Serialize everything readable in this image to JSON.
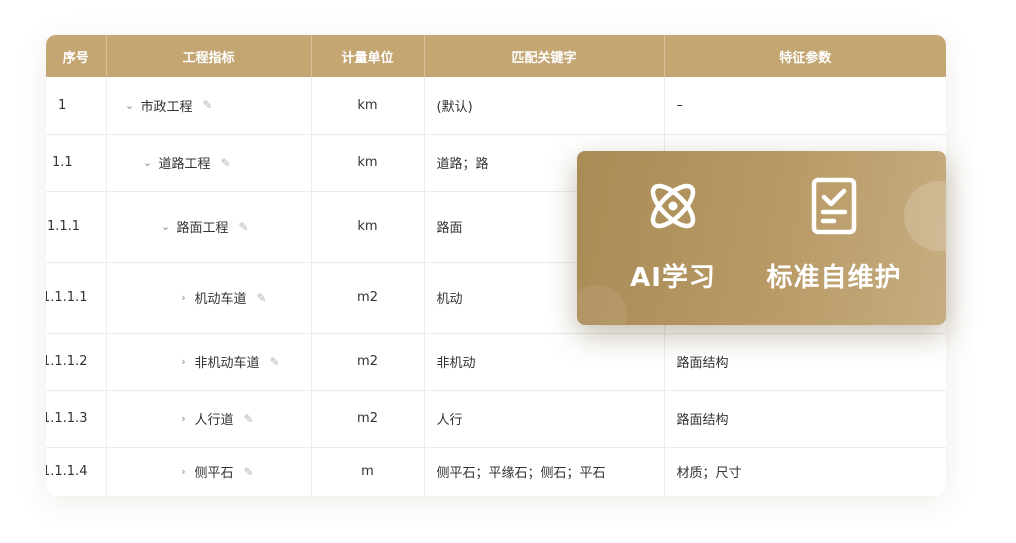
{
  "table": {
    "headers": {
      "seq": "序号",
      "indicator": "工程指标",
      "unit": "计量单位",
      "keywords": "匹配关键字",
      "features": "特征参数"
    },
    "rows": [
      {
        "seq": "1",
        "name": "市政工程",
        "caret": "⌄",
        "unit": "km",
        "keywords": "(默认)",
        "features": "–"
      },
      {
        "seq": "1.1",
        "name": "道路工程",
        "caret": "⌄",
        "unit": "km",
        "keywords": "道路；路",
        "features": ""
      },
      {
        "seq": "1.1.1",
        "name": "路面工程",
        "caret": "⌄",
        "unit": "km",
        "keywords": "路面",
        "features": ""
      },
      {
        "seq": "1.1.1.1",
        "name": "机动车道",
        "caret": "›",
        "unit": "m2",
        "keywords": "机动",
        "features": ""
      },
      {
        "seq": "1.1.1.2",
        "name": "非机动车道",
        "caret": "›",
        "unit": "m2",
        "keywords": "非机动",
        "features": "路面结构"
      },
      {
        "seq": "1.1.1.3",
        "name": "人行道",
        "caret": "›",
        "unit": "m2",
        "keywords": "人行",
        "features": "路面结构"
      },
      {
        "seq": "1.1.1.4",
        "name": "侧平石",
        "caret": "›",
        "unit": "m",
        "keywords": "侧平石；平缘石；侧石；平石",
        "features": "材质；尺寸"
      }
    ]
  },
  "popup": {
    "ai_label": "AI学习",
    "std_label": "标准自维护"
  },
  "icons": {
    "edit": "✎",
    "ai": "atom-icon",
    "std": "clipboard-check-icon"
  },
  "colors": {
    "header_bg": "#c4a673",
    "popup_bg": "#b0915e"
  }
}
